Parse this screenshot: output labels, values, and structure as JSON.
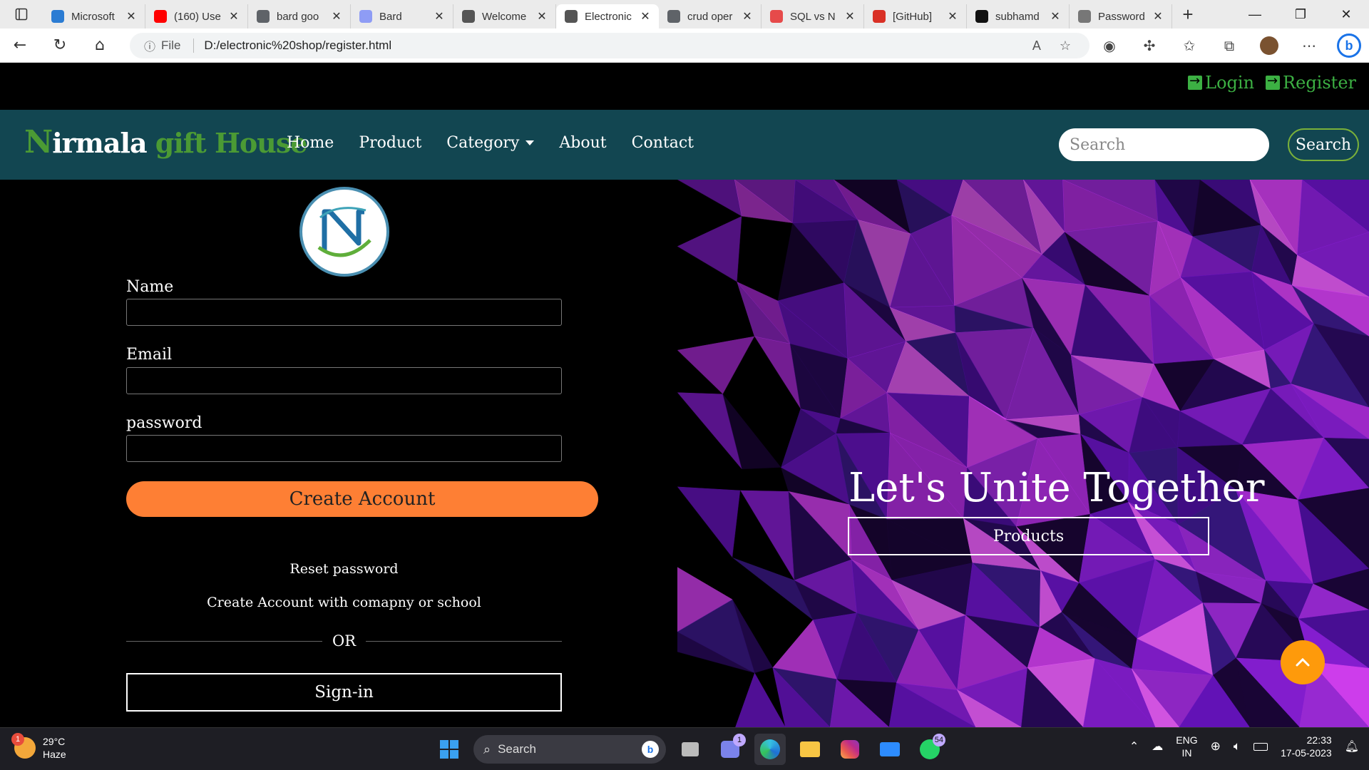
{
  "browser": {
    "tabs": [
      {
        "title": "Microsoft",
        "favicon_color": "#2b7cd3"
      },
      {
        "title": "(160) Use",
        "favicon_color": "#ff0000"
      },
      {
        "title": "bard goo",
        "favicon_color": "#5f6368"
      },
      {
        "title": "Bard",
        "favicon_color": "#8e9cf5"
      },
      {
        "title": "Welcome",
        "favicon_color": "#555555"
      },
      {
        "title": "Electronic",
        "favicon_color": "#555555",
        "active": true
      },
      {
        "title": "crud oper",
        "favicon_color": "#5f6368"
      },
      {
        "title": "SQL vs N",
        "favicon_color": "#e64a4a"
      },
      {
        "title": "[GitHub]",
        "favicon_color": "#d93025"
      },
      {
        "title": "subhamd",
        "favicon_color": "#111111"
      },
      {
        "title": "Password",
        "favicon_color": "#777777"
      }
    ],
    "address": {
      "scheme_label": "File",
      "url": "D:/electronic%20shop/register.html"
    }
  },
  "page": {
    "auth": {
      "login_label": "Login",
      "register_label": "Register"
    },
    "brand": {
      "first_letter": "N",
      "first_rest": "irmala",
      "gift": "gift",
      "house": "House"
    },
    "menu": [
      {
        "label": "Home"
      },
      {
        "label": "Product"
      },
      {
        "label": "Category"
      },
      {
        "label": "About"
      },
      {
        "label": "Contact"
      }
    ],
    "search": {
      "placeholder": "Search",
      "button_label": "Search"
    },
    "form": {
      "name_label": "Name",
      "email_label": "Email",
      "password_label": "password",
      "create_button": "Create Account",
      "reset_link": "Reset password",
      "company_link": "Create Account with comapny or school",
      "or_text": "OR",
      "signin_button": "Sign-in"
    },
    "hero": {
      "title": "Let's Unite Together",
      "button_label": "Products"
    },
    "colors": {
      "navbar": "#124651",
      "accent_orange": "#fe7f34",
      "brand_green": "#4b9a34",
      "auth_green": "#3cb043"
    }
  },
  "taskbar": {
    "weather_temp": "29°C",
    "weather_desc": "Haze",
    "weather_badge": "1",
    "search_label": "Search",
    "teams_badge": "1",
    "whatsapp_badge": "54",
    "lang_line1": "ENG",
    "lang_line2": "IN",
    "time": "22:33",
    "date": "17-05-2023"
  }
}
